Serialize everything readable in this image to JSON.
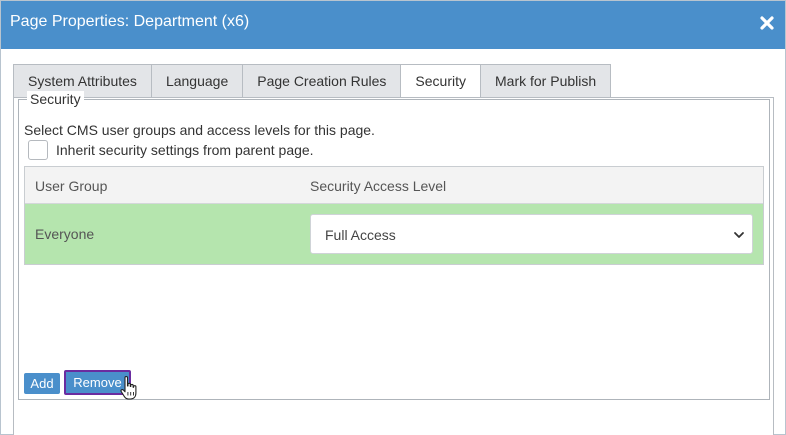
{
  "dialog": {
    "title": "Page Properties: Department (x6)",
    "close_icon": "close-icon"
  },
  "tabs": [
    {
      "label": "System Attributes",
      "active": false
    },
    {
      "label": "Language",
      "active": false
    },
    {
      "label": "Page Creation Rules",
      "active": false
    },
    {
      "label": "Security",
      "active": true
    },
    {
      "label": "Mark for Publish",
      "active": false
    }
  ],
  "security": {
    "legend": "Security",
    "description": "Select CMS user groups and access levels for this page.",
    "inherit_label": "Inherit security settings from parent page.",
    "inherit_checked": false,
    "columns": [
      "User Group",
      "Security Access Level"
    ],
    "rows": [
      {
        "group": "Everyone",
        "access": "Full Access",
        "selected": true
      }
    ],
    "add_label": "Add",
    "remove_label": "Remove"
  },
  "colors": {
    "titlebar": "#4a8fcb",
    "selected_row": "#b5e5ae",
    "button": "#4a8fcb",
    "focus_outline": "#6a2ca0"
  }
}
